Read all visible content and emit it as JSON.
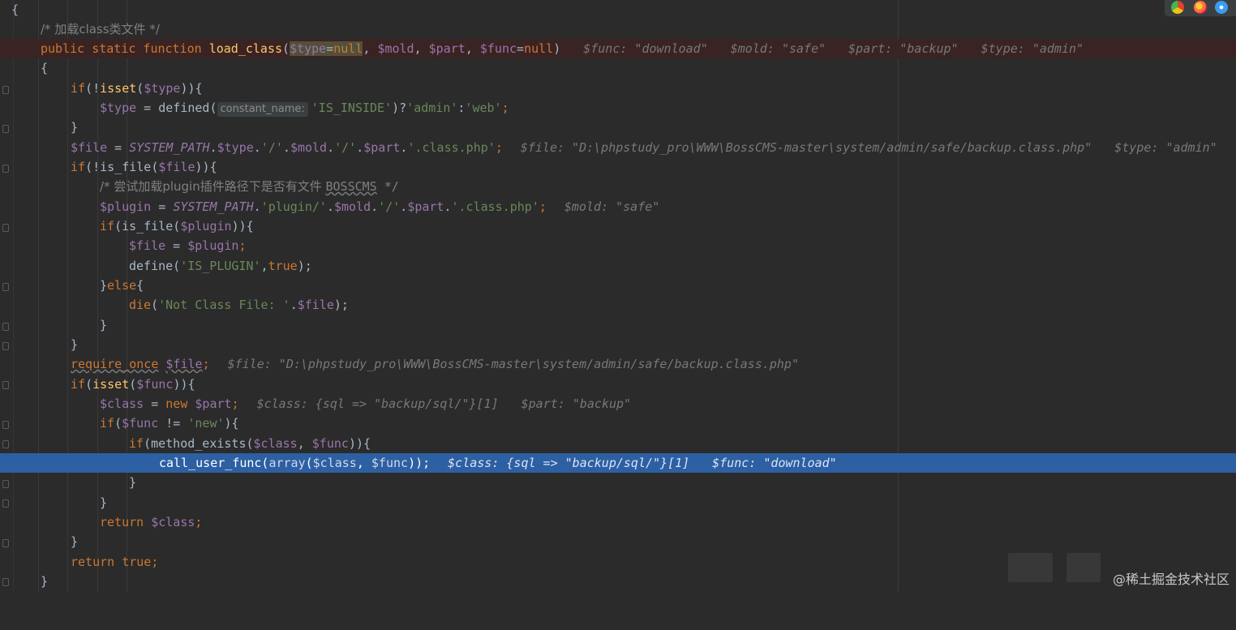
{
  "watermark": "@稀土掘金技术社区",
  "browser_icons": [
    "chrome-icon",
    "firefox-icon",
    "safari-icon"
  ],
  "colors": {
    "background": "#2b2b2b",
    "breakpoint_line": "#3a2323",
    "execution_line": "#2d5fa3",
    "keyword": "#cc7832",
    "variable": "#9876aa",
    "string": "#6a8759",
    "function": "#ffc66d",
    "comment": "#808080"
  },
  "code": {
    "l1": {
      "text": "{"
    },
    "l2": {
      "comment": "/* 加载class类文件 */"
    },
    "l3": {
      "kw": "public static function",
      "fn": "load_class",
      "p1": "(",
      "type_param": "$type",
      "eq": "=",
      "null1": "null",
      "comma1": ", ",
      "mold": "$mold",
      "comma2": ", ",
      "part": "$part",
      "comma3": ", ",
      "func": "$func",
      "eq2": "=",
      "null2": "null",
      "p2": ")",
      "hint1": "$func: \"download\"",
      "hint2": "$mold: \"safe\"",
      "hint3": "$part: \"backup\"",
      "hint4": "$type: \"admin\""
    },
    "l4": {
      "text": "{"
    },
    "l5": {
      "kw": "if",
      "t1": "(!",
      "fn": "isset",
      "t2": "(",
      "var": "$type",
      "t3": ")){"
    },
    "l6": {
      "var": "$type",
      "t1": " = defined(",
      "param_hint": "constant_name:",
      "str1": "'IS_INSIDE'",
      "t2": ")?",
      "str2": "'admin'",
      "t3": ":",
      "str3": "'web'",
      "t4": ";"
    },
    "l7": {
      "text": "}"
    },
    "l8": {
      "var1": "$file",
      "t1": " = ",
      "const": "SYSTEM_PATH",
      "t2": ".",
      "var2": "$type",
      "t3": ".",
      "str1": "'/'",
      "t4": ".",
      "var3": "$mold",
      "t5": ".",
      "str2": "'/'",
      "t6": ".",
      "var4": "$part",
      "t7": ".",
      "str3": "'.class.php'",
      "t8": ";",
      "hint1": "$file: \"D:\\phpstudy_pro\\WWW\\BossCMS-master\\system/admin/safe/backup.class.php\"",
      "hint2": "$type: \"admin\""
    },
    "l9": {
      "kw": "if",
      "t1": "(!is_file(",
      "var": "$file",
      "t2": ")){"
    },
    "l10": {
      "comment_a": "/* 尝试加载plugin插件路径下是否有文件 ",
      "comment_b": "BOSSCMS",
      "comment_c": " */"
    },
    "l11": {
      "var1": "$plugin",
      "t1": " = ",
      "const": "SYSTEM_PATH",
      "t2": ".",
      "str1": "'plugin/'",
      "t3": ".",
      "var2": "$mold",
      "t4": ".",
      "str2": "'/'",
      "t5": ".",
      "var3": "$part",
      "t6": ".",
      "str3": "'.class.php'",
      "t7": ";",
      "hint": "$mold: \"safe\""
    },
    "l12": {
      "kw": "if",
      "t1": "(is_file(",
      "var": "$plugin",
      "t2": ")){"
    },
    "l13": {
      "var1": "$file",
      "t1": " = ",
      "var2": "$plugin",
      "t2": ";"
    },
    "l14": {
      "t1": "define(",
      "str": "'IS_PLUGIN'",
      "t2": ",",
      "kw": "true",
      "t3": ");"
    },
    "l15": {
      "t1": "}",
      "kw": "else",
      "t2": "{"
    },
    "l16": {
      "t1": "die(",
      "str": "'Not Class File: '",
      "t2": ".",
      "var": "$file",
      "t3": ");"
    },
    "l17": {
      "text": "}"
    },
    "l18": {
      "text": "}"
    },
    "l19": {
      "kw": "require_once",
      "sp": " ",
      "var": "$file",
      "t1": ";",
      "hint": "$file: \"D:\\phpstudy_pro\\WWW\\BossCMS-master\\system/admin/safe/backup.class.php\""
    },
    "l20": {
      "kw": "if",
      "t1": "(",
      "fn": "isset",
      "t2": "(",
      "var": "$func",
      "t3": ")){"
    },
    "l21": {
      "var1": "$class",
      "t1": " = ",
      "kw": "new",
      "sp": " ",
      "var2": "$part",
      "t2": ";",
      "hint1": "$class: {sql => \"backup/sql/\"}[1]",
      "hint2": "$part: \"backup\""
    },
    "l22": {
      "kw": "if",
      "t1": "(",
      "var": "$func",
      "t2": " != ",
      "str": "'new'",
      "t3": "){"
    },
    "l23": {
      "kw": "if",
      "t1": "(method_exists(",
      "var1": "$class",
      "t2": ", ",
      "var2": "$func",
      "t3": ")){"
    },
    "l24": {
      "t1": "call_user_func(",
      "kw": "array",
      "t2": "(",
      "var1": "$class",
      "t3": ", ",
      "var2": "$func",
      "t4": "));",
      "hint1": "$class: {sql => \"backup/sql/\"}[1]",
      "hint2": "$func: \"download\""
    },
    "l25": {
      "text": "}"
    },
    "l26": {
      "text": "}"
    },
    "l27": {
      "kw": "return",
      "sp": " ",
      "var": "$class",
      "t1": ";"
    },
    "l28": {
      "text": "}"
    },
    "l29": {
      "kw": "return",
      "sp": " ",
      "kw2": "true",
      "t1": ";"
    },
    "l30": {
      "text": "}"
    }
  }
}
